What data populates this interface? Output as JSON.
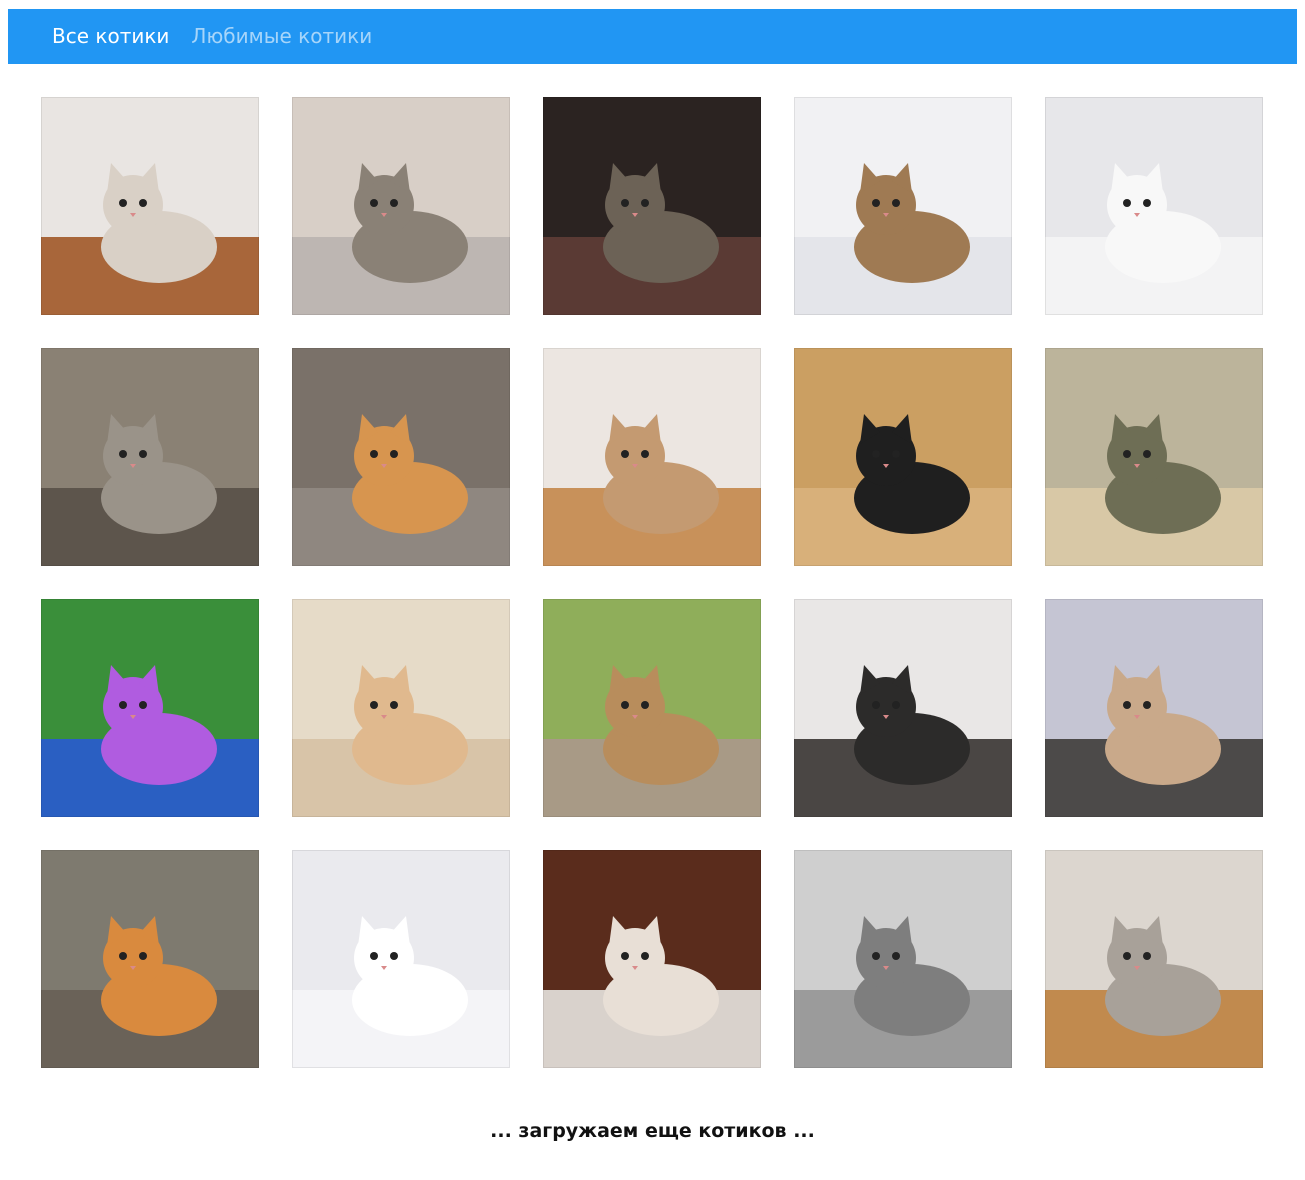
{
  "navbar": {
    "color": "#2196f3",
    "tabs": [
      {
        "label": "Все котики",
        "active": true
      },
      {
        "label": "Любимые котики",
        "active": false
      }
    ]
  },
  "gallery": {
    "photos": [
      {
        "subject": "cat-under-door",
        "bg": "#e9e5e2",
        "floor": "#a8663a",
        "cat": "#d9d0c6"
      },
      {
        "subject": "arched-tabby-cat",
        "bg": "#d8cfc7",
        "floor": "#bdb6b2",
        "cat": "#8a8176"
      },
      {
        "subject": "cat-in-tuxedo",
        "bg": "#2b2321",
        "floor": "#5a3a34",
        "cat": "#6c6256"
      },
      {
        "subject": "cat-in-basket",
        "bg": "#f1f1f3",
        "floor": "#e4e5ea",
        "cat": "#9f7a53"
      },
      {
        "subject": "white-cat-with-toy",
        "bg": "#e7e7ea",
        "floor": "#f3f3f4",
        "cat": "#f8f8f8"
      },
      {
        "subject": "kitten-in-kettle",
        "bg": "#8a8174",
        "floor": "#5d554c",
        "cat": "#9a9389"
      },
      {
        "subject": "ginger-cat-in-bed",
        "bg": "#7a7169",
        "floor": "#8f8780",
        "cat": "#d7954f"
      },
      {
        "subject": "cat-in-paper-bag",
        "bg": "#ece6e1",
        "floor": "#c8915a",
        "cat": "#c49a71"
      },
      {
        "subject": "cat-in-cardboard-box",
        "bg": "#cb9f62",
        "floor": "#d8b07a",
        "cat": "#1f1f1f"
      },
      {
        "subject": "tabby-cat-with-tea",
        "bg": "#bcb49b",
        "floor": "#d8c8a6",
        "cat": "#6e6e55"
      },
      {
        "subject": "psychedelic-space-cat",
        "bg": "#3a8f3a",
        "floor": "#2a5fc2",
        "cat": "#b05ce0"
      },
      {
        "subject": "kitten-in-blanket",
        "bg": "#e6dbc8",
        "floor": "#d8c4a8",
        "cat": "#e0b98e"
      },
      {
        "subject": "kittens-on-pavement",
        "bg": "#8fae5a",
        "floor": "#a89a86",
        "cat": "#b88d5c"
      },
      {
        "subject": "cat-in-striped-bag",
        "bg": "#e9e7e6",
        "floor": "#4a4644",
        "cat": "#2c2b2a"
      },
      {
        "subject": "cat-on-balcony",
        "bg": "#c5c5d3",
        "floor": "#4c4a49",
        "cat": "#c9a98a"
      },
      {
        "subject": "orange-kittens-outdoors",
        "bg": "#7e7a6f",
        "floor": "#6a6258",
        "cat": "#d98a3e"
      },
      {
        "subject": "fat-cat-in-snow",
        "bg": "#eaeaee",
        "floor": "#f4f4f7",
        "cat": "#ffffff"
      },
      {
        "subject": "cat-and-kitten",
        "bg": "#5a2c1c",
        "floor": "#d9d2cc",
        "cat": "#e8dfd6"
      },
      {
        "subject": "grey-cat-standing",
        "bg": "#cfcfcf",
        "floor": "#9b9b9b",
        "cat": "#7e7e7e"
      },
      {
        "subject": "grey-kitten-on-floor",
        "bg": "#dcd6cf",
        "floor": "#c18a4e",
        "cat": "#a8a199"
      }
    ]
  },
  "footer": {
    "loading_text": "... загружаем еще котиков ..."
  }
}
